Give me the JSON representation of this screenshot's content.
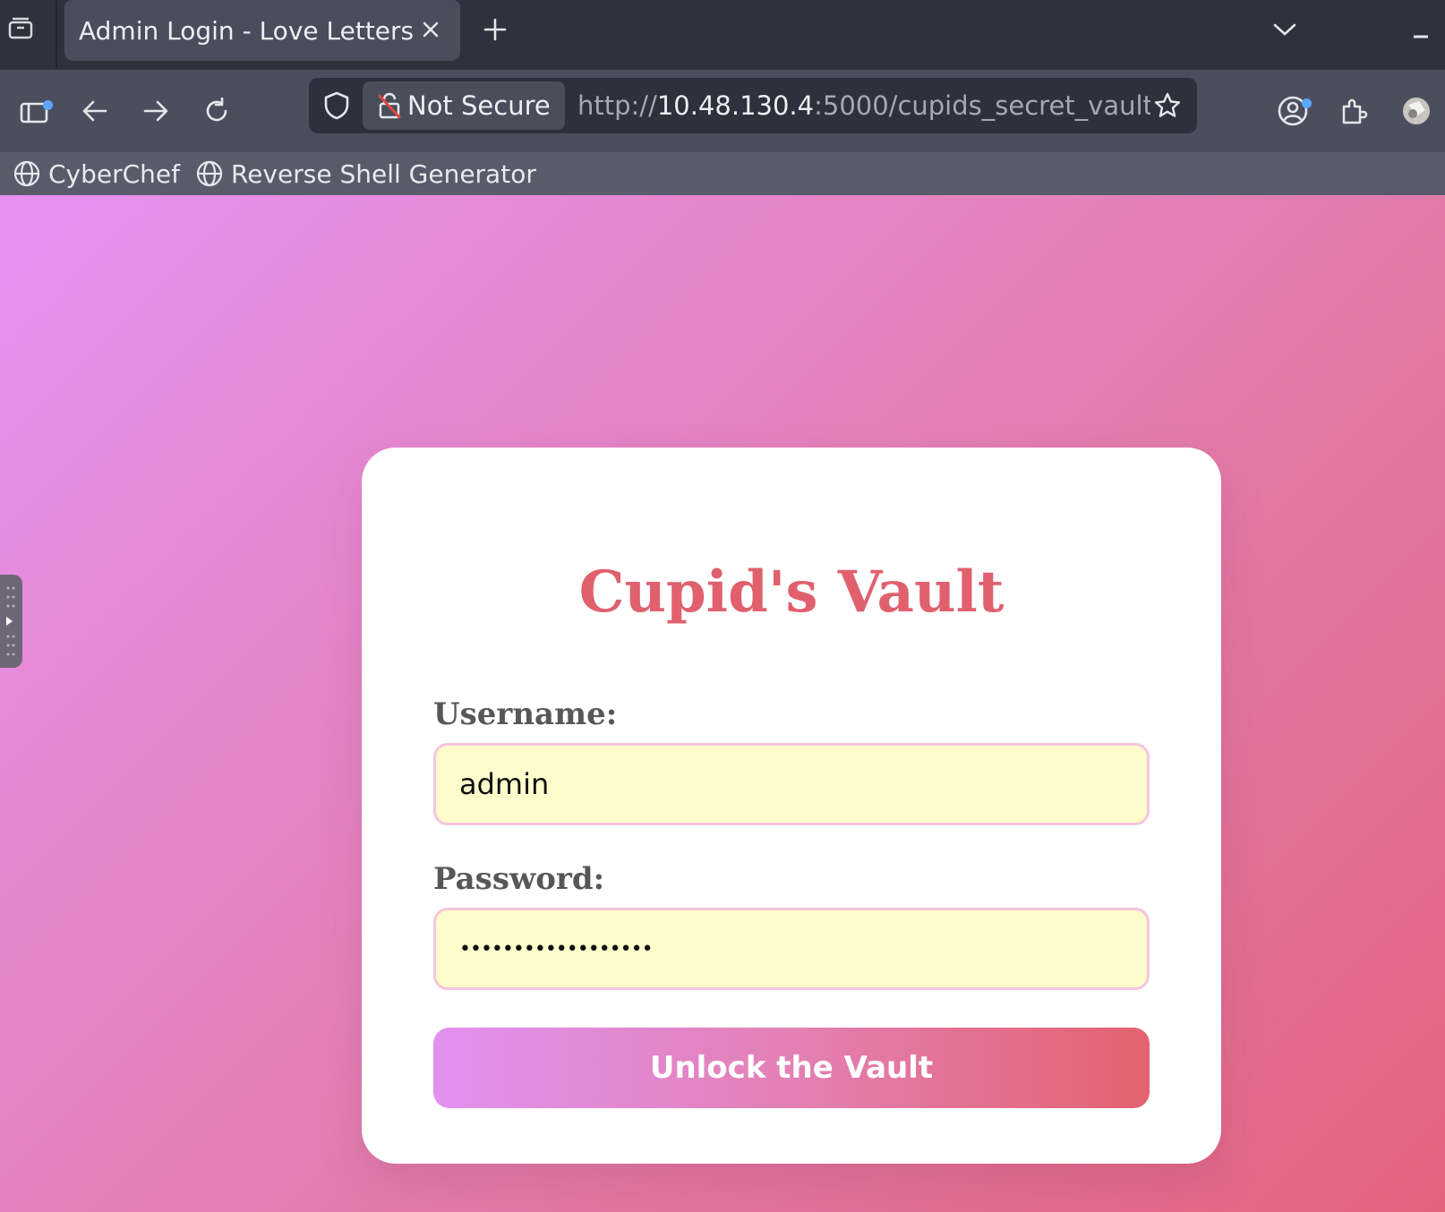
{
  "browser": {
    "tab_title": "Admin Login - Love Letters",
    "address": {
      "security_label": "Not Secure",
      "url_prefix": "http://",
      "url_host": "10.48.130.4",
      "url_rest": ":5000/cupids_secret_vault/"
    },
    "bookmarks": [
      {
        "label": "CyberChef"
      },
      {
        "label": "Reverse Shell Generator"
      }
    ]
  },
  "page": {
    "title": "Cupid's Vault",
    "username_label": "Username:",
    "username_value": "admin",
    "password_label": "Password:",
    "password_value": "••••••••••••••••••",
    "submit_label": "Unlock the Vault"
  },
  "colors": {
    "title": "#e0606e",
    "field_bg": "#fffccc",
    "field_border": "#f7c5dc",
    "gradient_start": "#e891f2",
    "gradient_end": "#e3637d"
  }
}
